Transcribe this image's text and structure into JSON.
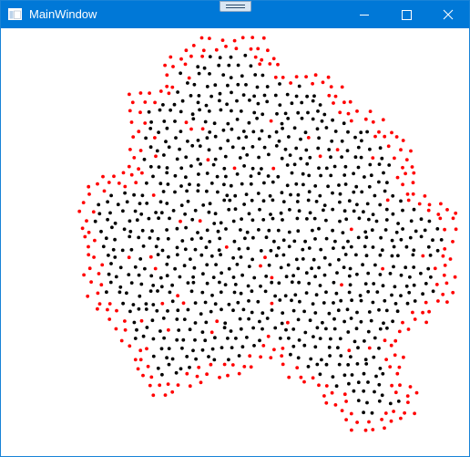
{
  "window": {
    "title": "MainWindow",
    "titlebar_color": "#0078d7",
    "border_color": "#1883d7",
    "background": "#ffffff"
  },
  "titlebar": {
    "icon": "app-window-icon",
    "grip_icon": "drag-grip-icon",
    "buttons": [
      {
        "name": "minimize",
        "icon": "minimize-icon"
      },
      {
        "name": "maximize",
        "icon": "maximize-icon"
      },
      {
        "name": "close",
        "icon": "close-icon"
      }
    ]
  },
  "canvas": {
    "background": "#ffffff",
    "point_colors": {
      "boundary": "#ff0000",
      "interior": "#000000"
    }
  }
}
